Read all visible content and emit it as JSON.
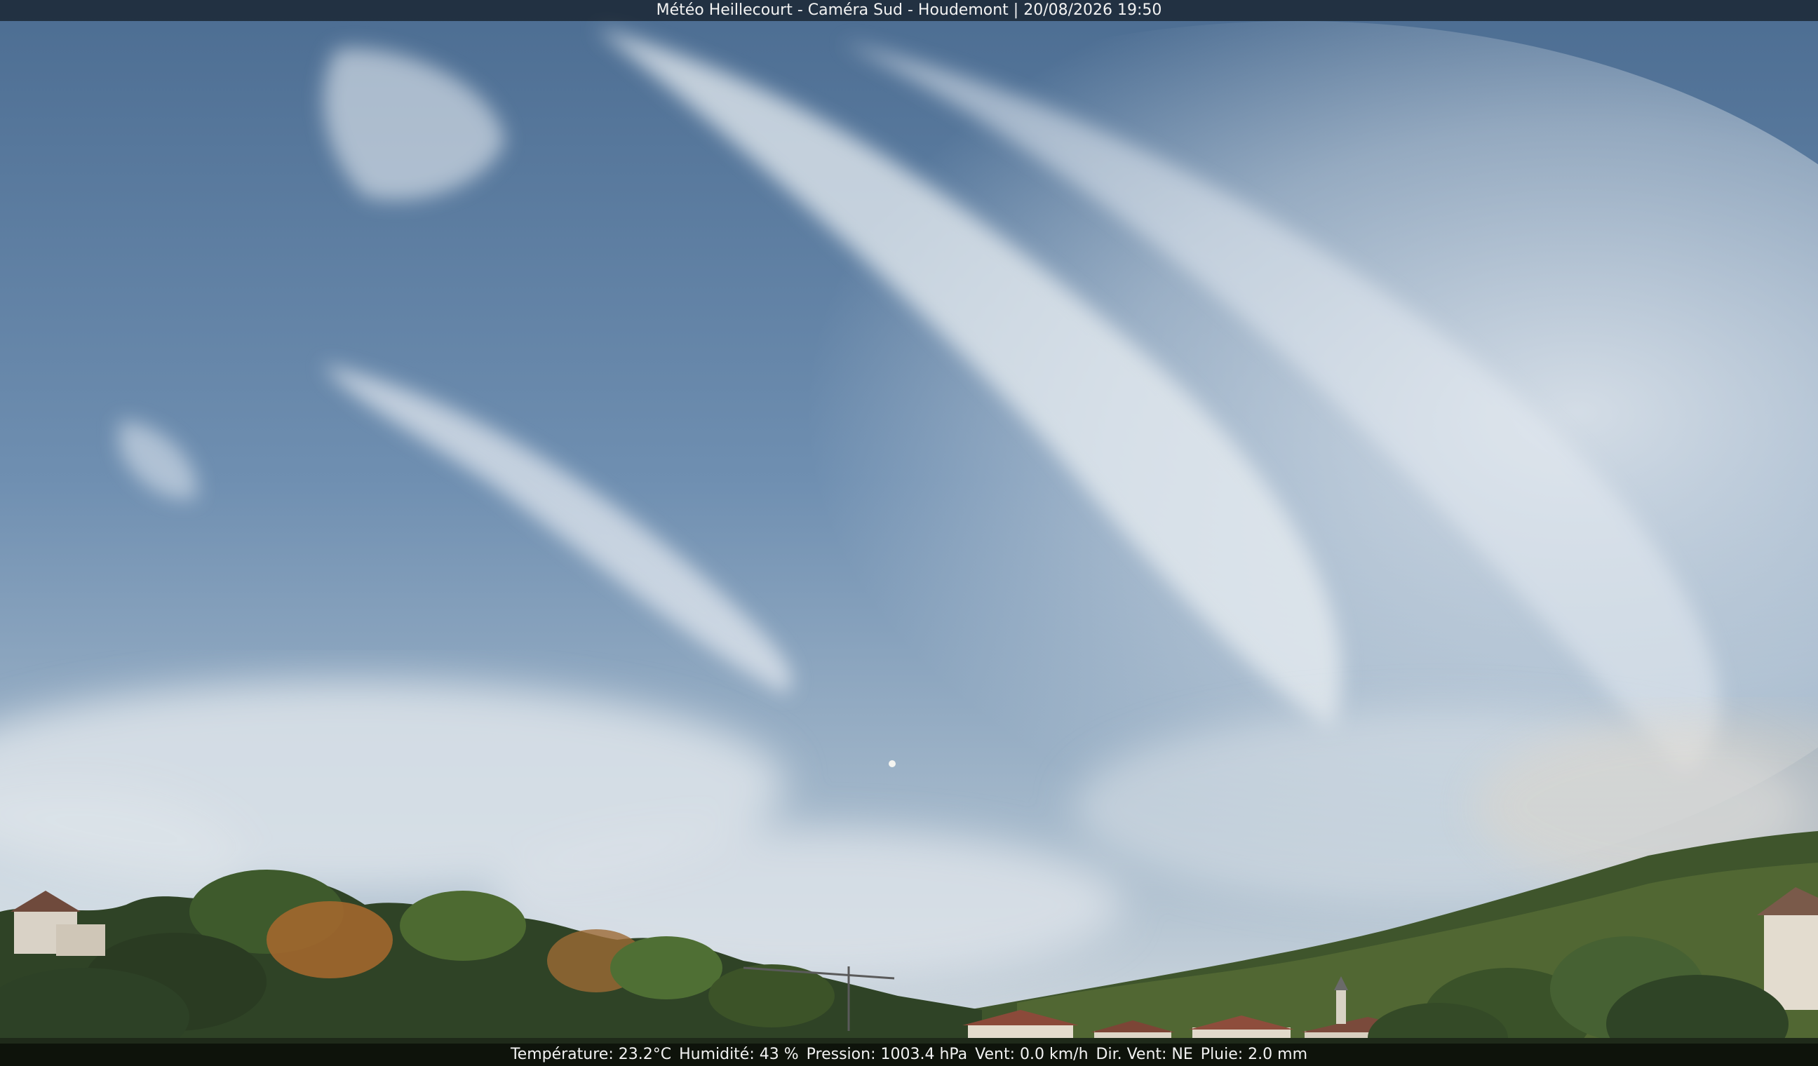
{
  "header": {
    "caption": "Météo Heillecourt - Caméra Sud - Houdemont | 20/08/2026 19:50"
  },
  "weather": {
    "temperature": "Température: 23.2°C",
    "humidity": "Humidité: 43 %",
    "pressure": "Pression: 1003.4 hPa",
    "wind": "Vent: 0.0 km/h",
    "direction": "Dir. Vent: NE",
    "rain": "Pluie: 2.0 mm"
  },
  "colors": {
    "sky_top": "#4f6f93",
    "sky_mid": "#7f9cba",
    "sky_horizon": "#c9d3db",
    "cloud": "#e9edf1",
    "trees_dark": "#2b3a24",
    "trees_mid": "#4c6233",
    "trees_autumn": "#a8682e",
    "roof": "#8b4a3a"
  }
}
